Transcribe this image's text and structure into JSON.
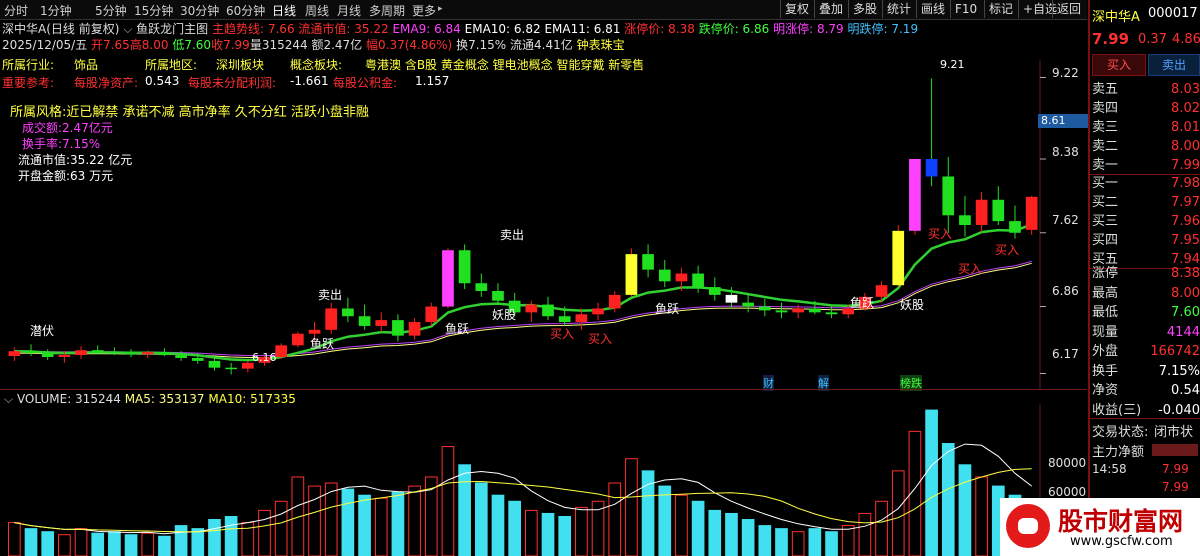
{
  "toolbar": {
    "tabs": [
      "分时",
      "1分钟",
      "5分钟",
      "15分钟",
      "30分钟",
      "60分钟",
      "日线",
      "周线",
      "月线",
      "多周期",
      "更多"
    ],
    "selected_tab": "日线",
    "buttons": [
      "复权",
      "叠加",
      "多股",
      "统计",
      "画线",
      "F10",
      "标记",
      "+自选",
      "返回"
    ]
  },
  "info_line1": {
    "stock": "深中华A(日线 前复权)",
    "indicator": "鱼跃龙门主图",
    "items": [
      {
        "label": "主趋势线:",
        "value": "7.66",
        "color": "#ff3030"
      },
      {
        "label": "流通市值:",
        "value": "35.22",
        "color": "#ff3030"
      },
      {
        "label": "EMA9:",
        "value": "6.84",
        "color": "#ff40ff"
      },
      {
        "label": "EMA10:",
        "value": "6.82",
        "color": "#ffffff"
      },
      {
        "label": "EMA11:",
        "value": "6.81",
        "color": "#ffffff"
      },
      {
        "label": "涨停价:",
        "value": "8.38",
        "color": "#ff3030"
      },
      {
        "label": "跌停价:",
        "value": "6.86",
        "color": "#40ff40"
      },
      {
        "label": "明涨停:",
        "value": "8.79",
        "color": "#ff40ff"
      },
      {
        "label": "明跌停:",
        "value": "7.19",
        "color": "#40c0ff"
      }
    ]
  },
  "info_line2": {
    "date": "2025/12/05/五",
    "open": "开7.65",
    "high": "高8.00",
    "low": "低7.60",
    "close": "收7.99",
    "volume": "量315244",
    "amount": "额2.47亿",
    "change": "幅0.37(4.86%)",
    "turnover": "换7.15%",
    "float": "流通4.41亿",
    "tag": "钟表珠宝"
  },
  "company": {
    "industry_label": "所属行业:",
    "industry": "饰品",
    "region_label": "所属地区:",
    "region": "深圳板块",
    "concept_label": "概念板块:",
    "concepts": "粤港澳 含B股 黄金概念 锂电池概念 智能穿戴 新零售",
    "ref_label": "重要参考:",
    "nav_label": "每股净资产:",
    "nav": "0.543",
    "undist_label": "每股未分配利润:",
    "undist": "-1.661",
    "reserve_label": "每股公积金:",
    "reserve": "1.157",
    "style": "所属风格:近已解禁 承诺不减 高市净率 久不分红 活跃小盘非融"
  },
  "stats": {
    "turnover_amount": "成交额:2.47亿元",
    "turnover_rate": "换手率:7.15%",
    "float_value": "流通市值:35.22 亿元",
    "open_amount": "开盘金额:63 万元"
  },
  "price_axis": [
    "9.22",
    "8.38",
    "7.62",
    "6.86",
    "6.17"
  ],
  "current_price_label": "8.61",
  "annotations": {
    "high_mark": "9.21",
    "low_mark": "6.16",
    "sell1": "卖出",
    "sell2": "卖出",
    "buy_labels": [
      "买入",
      "买入",
      "买入",
      "买入",
      "买入"
    ],
    "yuyue": "鱼跃",
    "yaogu": "妖股",
    "qianfu": "潜伏",
    "cai": "财",
    "jie": "解",
    "lu": "榜跌"
  },
  "volume_header": {
    "volume": "VOLUME: 315244",
    "ma5": "MA5: 353137",
    "ma10": "MA10: 517335"
  },
  "volume_axis": [
    "80000",
    "60000",
    "40000"
  ],
  "right_panel": {
    "name": "深中华A",
    "code": "000017",
    "price": "7.99",
    "change": "0.37",
    "pct": "4.86",
    "buy_btn": "买入",
    "sell_btn": "卖出",
    "asks": [
      {
        "label": "卖五",
        "price": "8.03"
      },
      {
        "label": "卖四",
        "price": "8.02"
      },
      {
        "label": "卖三",
        "price": "8.01"
      },
      {
        "label": "卖二",
        "price": "8.00"
      },
      {
        "label": "卖一",
        "price": "7.99"
      }
    ],
    "bids": [
      {
        "label": "买一",
        "price": "7.98"
      },
      {
        "label": "买二",
        "price": "7.97"
      },
      {
        "label": "买三",
        "price": "7.96"
      },
      {
        "label": "买四",
        "price": "7.95"
      },
      {
        "label": "买五",
        "price": "7.94"
      }
    ],
    "quotes": [
      {
        "label": "涨停",
        "value": "8.38",
        "color": "#ff3030"
      },
      {
        "label": "最高",
        "value": "8.00",
        "color": "#ff3030"
      },
      {
        "label": "最低",
        "value": "7.60",
        "color": "#40ff40"
      },
      {
        "label": "现量",
        "value": "4144",
        "color": "#ff40ff"
      },
      {
        "label": "外盘",
        "value": "166742",
        "color": "#ff3030"
      },
      {
        "label": "换手",
        "value": "7.15%",
        "color": "#ffffff"
      },
      {
        "label": "净资",
        "value": "0.54",
        "color": "#ffffff"
      },
      {
        "label": "收益(三)",
        "value": "-0.040",
        "color": "#ffffff"
      }
    ],
    "status_label": "交易状态:",
    "status": "闭市状",
    "net_flow_label": "主力净额",
    "ticks": [
      {
        "time": "14:58",
        "price": "7.99"
      },
      {
        "time": "",
        "price": "7.99"
      }
    ]
  },
  "watermark": {
    "text": "股市财富网",
    "url": "www.gscfw.com"
  },
  "chart_data": {
    "type": "candlestick",
    "ylim": [
      6.0,
      9.4
    ],
    "candles": [
      [
        6.35,
        6.44,
        6.3,
        6.4
      ],
      [
        6.4,
        6.47,
        6.35,
        6.38
      ],
      [
        6.38,
        6.42,
        6.31,
        6.34
      ],
      [
        6.34,
        6.4,
        6.28,
        6.36
      ],
      [
        6.36,
        6.45,
        6.32,
        6.41
      ],
      [
        6.41,
        6.46,
        6.37,
        6.39
      ],
      [
        6.39,
        6.44,
        6.36,
        6.38
      ],
      [
        6.38,
        6.42,
        6.34,
        6.37
      ],
      [
        6.37,
        6.41,
        6.33,
        6.39
      ],
      [
        6.39,
        6.43,
        6.35,
        6.36
      ],
      [
        6.36,
        6.4,
        6.3,
        6.33
      ],
      [
        6.33,
        6.38,
        6.27,
        6.3
      ],
      [
        6.3,
        6.34,
        6.2,
        6.23
      ],
      [
        6.23,
        6.28,
        6.16,
        6.22
      ],
      [
        6.22,
        6.3,
        6.18,
        6.28
      ],
      [
        6.28,
        6.36,
        6.25,
        6.34
      ],
      [
        6.34,
        6.48,
        6.32,
        6.46
      ],
      [
        6.46,
        6.6,
        6.44,
        6.58
      ],
      [
        6.58,
        6.7,
        6.5,
        6.62
      ],
      [
        6.62,
        6.9,
        6.58,
        6.84
      ],
      [
        6.84,
        6.95,
        6.7,
        6.76
      ],
      [
        6.76,
        6.88,
        6.62,
        6.66
      ],
      [
        6.66,
        6.8,
        6.6,
        6.72
      ],
      [
        6.72,
        6.78,
        6.5,
        6.56
      ],
      [
        6.56,
        6.74,
        6.52,
        6.7
      ],
      [
        6.7,
        6.9,
        6.66,
        6.86
      ],
      [
        6.86,
        7.46,
        6.84,
        7.44
      ],
      [
        7.44,
        7.5,
        7.04,
        7.1
      ],
      [
        7.1,
        7.2,
        6.96,
        7.02
      ],
      [
        7.02,
        7.1,
        6.88,
        6.92
      ],
      [
        6.92,
        7.0,
        6.76,
        6.8
      ],
      [
        6.8,
        6.92,
        6.7,
        6.88
      ],
      [
        6.88,
        6.96,
        6.72,
        6.76
      ],
      [
        6.76,
        6.86,
        6.66,
        6.7
      ],
      [
        6.7,
        6.84,
        6.62,
        6.78
      ],
      [
        6.78,
        6.9,
        6.72,
        6.84
      ],
      [
        6.84,
        7.02,
        6.8,
        6.98
      ],
      [
        6.98,
        7.46,
        6.96,
        7.4
      ],
      [
        7.4,
        7.5,
        7.16,
        7.24
      ],
      [
        7.24,
        7.34,
        7.06,
        7.12
      ],
      [
        7.12,
        7.26,
        7.02,
        7.2
      ],
      [
        7.2,
        7.28,
        7.0,
        7.06
      ],
      [
        7.06,
        7.16,
        6.92,
        6.98
      ],
      [
        6.98,
        7.06,
        6.84,
        6.9
      ],
      [
        6.9,
        6.98,
        6.8,
        6.86
      ],
      [
        6.86,
        6.94,
        6.76,
        6.82
      ],
      [
        6.82,
        6.9,
        6.74,
        6.8
      ],
      [
        6.8,
        6.88,
        6.74,
        6.84
      ],
      [
        6.84,
        6.92,
        6.78,
        6.8
      ],
      [
        6.8,
        6.86,
        6.74,
        6.78
      ],
      [
        6.78,
        6.88,
        6.74,
        6.84
      ],
      [
        6.84,
        7.0,
        6.82,
        6.96
      ],
      [
        6.96,
        7.12,
        6.9,
        7.08
      ],
      [
        7.08,
        7.7,
        7.06,
        7.64
      ],
      [
        7.64,
        8.38,
        7.6,
        8.38
      ],
      [
        8.38,
        9.21,
        8.1,
        8.2
      ],
      [
        8.2,
        8.4,
        7.62,
        7.8
      ],
      [
        7.8,
        8.0,
        7.58,
        7.7
      ],
      [
        7.7,
        8.04,
        7.62,
        7.96
      ],
      [
        7.96,
        8.1,
        7.7,
        7.74
      ],
      [
        7.74,
        7.9,
        7.56,
        7.62
      ],
      [
        7.65,
        8.0,
        7.6,
        7.99
      ]
    ],
    "volume_ylim": [
      0,
      100000
    ],
    "volumes": [
      22000,
      18000,
      16000,
      14000,
      18000,
      15000,
      16000,
      14000,
      15000,
      13000,
      20000,
      18000,
      24000,
      26000,
      22000,
      30000,
      36000,
      52000,
      46000,
      48000,
      44000,
      40000,
      38000,
      42000,
      46000,
      52000,
      72000,
      60000,
      48000,
      40000,
      36000,
      30000,
      28000,
      26000,
      32000,
      36000,
      48000,
      64000,
      56000,
      46000,
      40000,
      36000,
      30000,
      28000,
      24000,
      20000,
      18000,
      16000,
      18000,
      16000,
      20000,
      28000,
      36000,
      56000,
      82000,
      96000,
      74000,
      60000,
      52000,
      46000,
      40000,
      32000
    ]
  }
}
